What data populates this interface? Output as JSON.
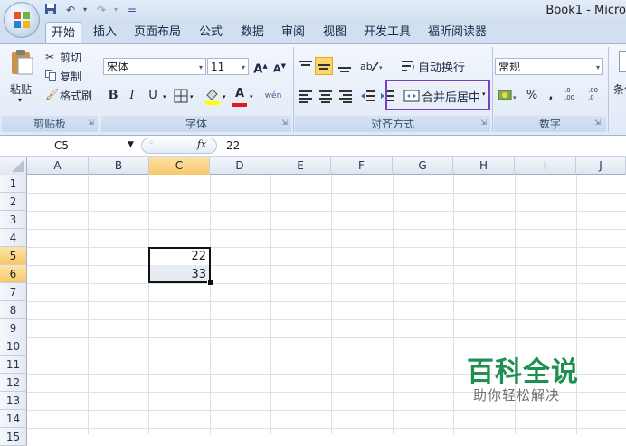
{
  "window": {
    "title": "Book1 - Micro"
  },
  "quick_access": {
    "save_icon": "save-icon",
    "undo_icon": "undo-icon",
    "redo_icon": "redo-icon",
    "customize": "="
  },
  "tabs": [
    "开始",
    "插入",
    "页面布局",
    "公式",
    "数据",
    "审阅",
    "视图",
    "开发工具",
    "福昕阅读器"
  ],
  "clipboard": {
    "paste": "粘贴",
    "cut": "剪切",
    "copy": "复制",
    "format_painter": "格式刷",
    "group": "剪贴板"
  },
  "font": {
    "name": "宋体",
    "size": "11",
    "grow": "A",
    "shrink": "A",
    "bold": "B",
    "italic": "I",
    "underline": "U",
    "font_color": "A",
    "phonetic": "wén",
    "group": "字体"
  },
  "alignment": {
    "wrap_text": "自动换行",
    "merge_center": "合并后居中",
    "group": "对齐方式"
  },
  "number": {
    "format": "常规",
    "percent": "%",
    "comma": ",",
    "increase_decimal": ".0\n.00",
    "decrease_decimal": ".00\n.0",
    "group": "数字"
  },
  "styles": {
    "conditional": "条件"
  },
  "formula_bar": {
    "name_box": "C5",
    "fx": "fx",
    "value": "22"
  },
  "columns": [
    "A",
    "B",
    "C",
    "D",
    "E",
    "F",
    "G",
    "H",
    "I",
    "J"
  ],
  "rows": [
    "1",
    "2",
    "3",
    "4",
    "5",
    "6",
    "7",
    "8",
    "9",
    "10",
    "11",
    "12",
    "13",
    "14",
    "15"
  ],
  "cells": {
    "C5": "22",
    "C6": "33"
  },
  "watermark": {
    "title": "百科全说",
    "subtitle": "助你轻松解决"
  },
  "colors": {
    "accent": "#7b3fc4",
    "ribbon": "#dfe9f6",
    "selected_header": "#f8c86a"
  }
}
